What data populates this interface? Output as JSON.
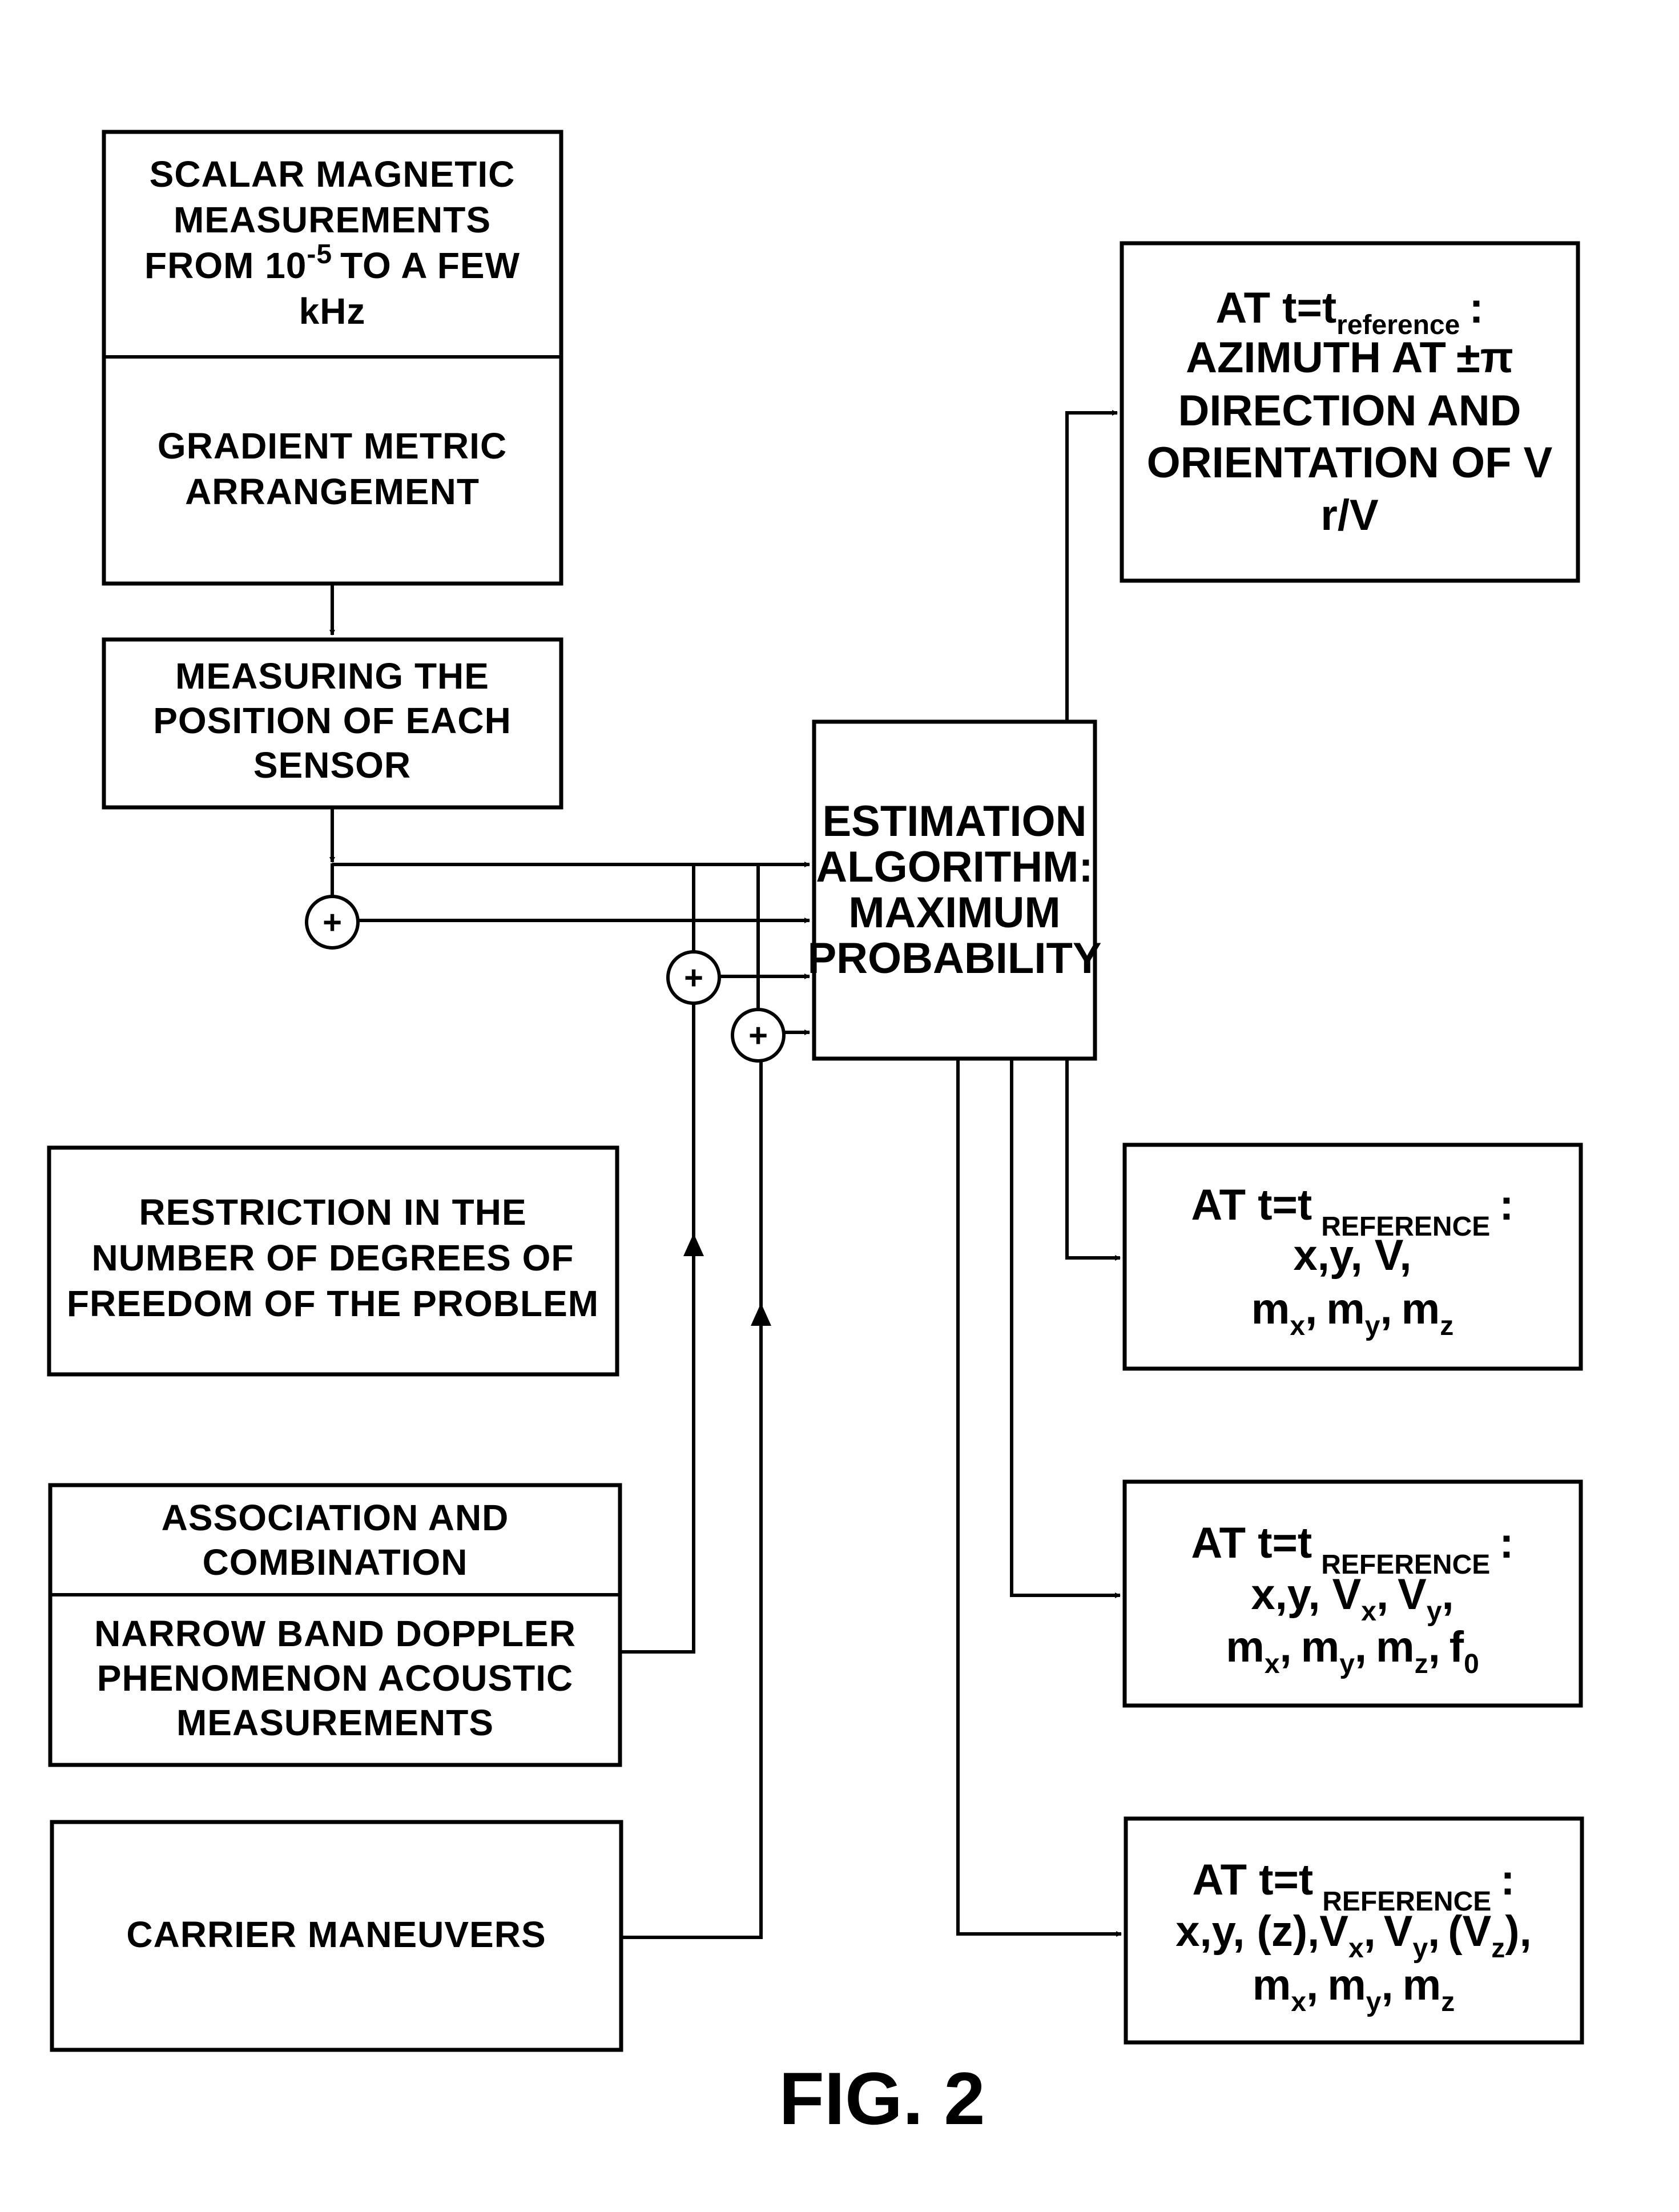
{
  "figure": {
    "caption": "FIG. 2"
  },
  "inputs": {
    "scalar_magnetic": {
      "lines": [
        "SCALAR MAGNETIC",
        "MEASUREMENTS",
        "FROM 10",
        "TO A FEW",
        "kHz"
      ],
      "exponent": "-5"
    },
    "gradient_metric": {
      "lines": [
        "GRADIENT METRIC",
        "ARRANGEMENT"
      ]
    },
    "measuring_position": {
      "lines": [
        "MEASURING THE",
        "POSITION OF EACH",
        "SENSOR"
      ]
    },
    "restriction": {
      "lines": [
        "RESTRICTION IN THE",
        "NUMBER OF DEGREES OF",
        "FREEDOM OF THE PROBLEM"
      ]
    },
    "association": {
      "lines": [
        "ASSOCIATION AND",
        "COMBINATION"
      ]
    },
    "doppler": {
      "lines": [
        "NARROW BAND DOPPLER",
        "PHENOMENON ACOUSTIC",
        "MEASUREMENTS"
      ]
    },
    "carrier": {
      "lines": [
        "CARRIER MANEUVERS"
      ]
    }
  },
  "estimator": {
    "lines": [
      "ESTIMATION",
      "ALGORITHM:",
      "MAXIMUM",
      "PROBABILITY"
    ]
  },
  "combiners": {
    "symbol": "+"
  },
  "outputs": {
    "azimuth": {
      "prefix": "AT t=t",
      "subscript": "reference",
      "colon": ":",
      "line2": "AZIMUTH AT",
      "plusminus": "±",
      "pi": "π",
      "line3": "DIRECTION AND",
      "line4": "ORIENTATION OF V",
      "line5": "r/V"
    },
    "out1": {
      "prefix": "AT t=t",
      "subscript": "REFERENCE",
      "colon": ":",
      "line2": "x,y, V,",
      "line3": [
        {
          "base": "m",
          "sub": "x",
          "sep": ","
        },
        {
          "base": "m",
          "sub": "y",
          "sep": ","
        },
        {
          "base": "m",
          "sub": "z",
          "sep": ""
        }
      ]
    },
    "out2": {
      "prefix": "AT t=t",
      "subscript": "REFERENCE",
      "colon": ":",
      "line2": [
        {
          "base": "x,y, V",
          "sub": "x",
          "sep": ","
        },
        {
          "base": "V",
          "sub": "y",
          "sep": ","
        }
      ],
      "line3": [
        {
          "base": "m",
          "sub": "x",
          "sep": ","
        },
        {
          "base": "m",
          "sub": "y",
          "sep": ","
        },
        {
          "base": "m",
          "sub": "z",
          "sep": ","
        },
        {
          "base": "f",
          "sub": "0",
          "sep": ""
        }
      ]
    },
    "out3": {
      "prefix": "AT t=t",
      "subscript": "REFERENCE",
      "colon": ":",
      "line2": [
        {
          "base": "x,y, (z),V",
          "sub": "x",
          "sep": ","
        },
        {
          "base": "V",
          "sub": "y",
          "sep": ","
        },
        {
          "base": "(V",
          "sub": "z",
          "sep": "),"
        }
      ],
      "line3": [
        {
          "base": "m",
          "sub": "x",
          "sep": ","
        },
        {
          "base": "m",
          "sub": "y",
          "sep": ","
        },
        {
          "base": "m",
          "sub": "z",
          "sep": ""
        }
      ]
    }
  }
}
